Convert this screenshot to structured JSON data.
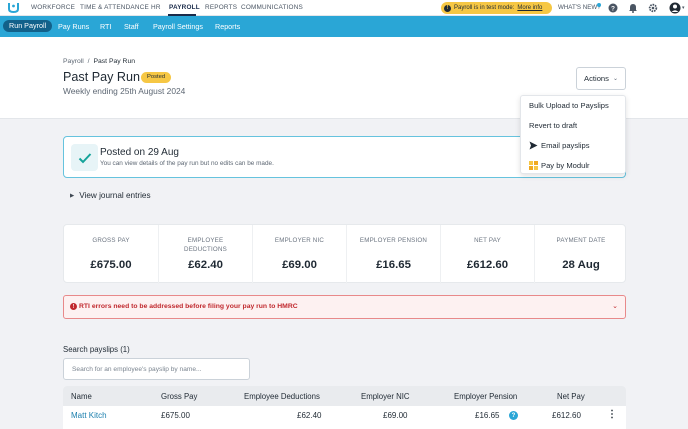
{
  "topnav": {
    "items": [
      "WORKFORCE",
      "TIME & ATTENDANCE",
      "HR",
      "PAYROLL",
      "REPORTS",
      "COMMUNICATIONS"
    ],
    "active": "PAYROLL",
    "test_banner": "Payroll is in test mode:",
    "test_banner_link": "More info",
    "whats_new": "WHAT'S NEW?",
    "icons": [
      "logo-icon",
      "help-icon",
      "notifications-icon",
      "settings-icon",
      "user-avatar-icon"
    ]
  },
  "subnav": {
    "items": [
      "Run Payroll",
      "Pay Runs",
      "RTI",
      "Staff",
      "Payroll Settings",
      "Reports"
    ],
    "active": "Run Payroll"
  },
  "header": {
    "breadcrumb_root": "Payroll",
    "breadcrumb_sep": "/",
    "breadcrumb_current": "Past Pay Run",
    "title": "Past Pay Run",
    "badge": "Posted",
    "subtitle": "Weekly ending 25th August 2024",
    "actions_label": "Actions"
  },
  "actions_menu": {
    "items": [
      {
        "label": "Bulk Upload to Payslips",
        "icon": ""
      },
      {
        "label": "Revert to draft",
        "icon": ""
      },
      {
        "label": "Email payslips",
        "icon": "send-icon"
      },
      {
        "label": "Pay by Modulr",
        "icon": "modulr-icon"
      }
    ]
  },
  "posted_card": {
    "title": "Posted on 29 Aug",
    "subtitle": "You can view details of the pay run but no edits can be made."
  },
  "journal_label": "View journal entries",
  "summary": [
    {
      "label": "GROSS PAY",
      "value": "£675.00"
    },
    {
      "label": "EMPLOYEE DEDUCTIONS",
      "value": "£62.40"
    },
    {
      "label": "EMPLOYER NIC",
      "value": "£69.00"
    },
    {
      "label": "EMPLOYER PENSION",
      "value": "£16.65"
    },
    {
      "label": "NET PAY",
      "value": "£612.60"
    },
    {
      "label": "PAYMENT DATE",
      "value": "28 Aug"
    }
  ],
  "rti_alert": "RTI errors need to be addressed before filing your pay run to HMRC",
  "search": {
    "label": "Search payslips (1)",
    "placeholder": "Search for an employee's payslip by name..."
  },
  "table": {
    "columns": [
      "Name",
      "Gross Pay",
      "Employee Deductions",
      "Employer NIC",
      "Employer Pension",
      "Net Pay"
    ],
    "rows": [
      {
        "name": "Matt Kitch",
        "gross": "£675.00",
        "deductions": "£62.40",
        "nic": "£69.00",
        "pension": "£16.65",
        "net": "£612.60"
      }
    ]
  },
  "colors": {
    "brand_blue": "#2aa6d6",
    "active_pill": "#12618a",
    "badge_yellow": "#f6c744",
    "error_red": "#c0282d"
  }
}
